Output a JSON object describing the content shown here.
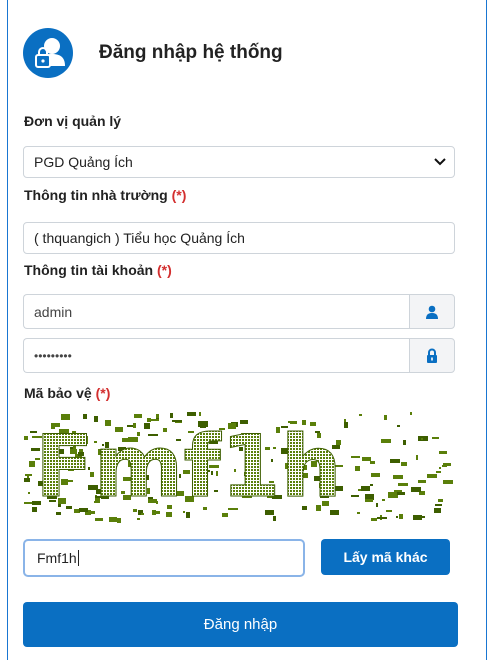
{
  "header": {
    "title": "Đăng nhập hệ thống",
    "icon": "user-lock-icon"
  },
  "unit": {
    "label": "Đơn vị quản lý",
    "selected": "PGD Quảng Ích"
  },
  "school": {
    "label": "Thông tin nhà trường",
    "required_mark": "(*)",
    "value": "( thquangich ) Tiểu học Quảng Ích"
  },
  "account": {
    "label": "Thông tin tài khoản",
    "required_mark": "(*)",
    "username": "admin",
    "password_mask": "•••••••••"
  },
  "captcha": {
    "label": "Mã bảo vệ",
    "required_mark": "(*)",
    "image_text": "Fmf1h",
    "input_value": "Fmf1h",
    "refresh_label": "Lấy mã khác"
  },
  "login_button": "Đăng nhập",
  "colors": {
    "primary": "#0a6fc2",
    "required": "#d32f2f",
    "captcha": "#5a7f0a"
  }
}
